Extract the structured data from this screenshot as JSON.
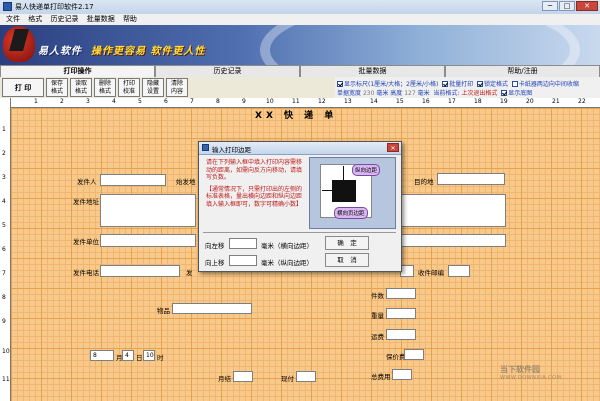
{
  "window": {
    "title": "易人快递单打印软件2.17",
    "min": "─",
    "max": "□",
    "close": "✕"
  },
  "menu": [
    "文件",
    "格式",
    "历史记录",
    "批量数据",
    "帮助"
  ],
  "banner": {
    "slogan_a": "易人软件",
    "slogan_b": "操作更容易  软件更人性"
  },
  "tabs": [
    "打印操作",
    "历史记录",
    "批量数据",
    "帮助/注册"
  ],
  "toolbar": {
    "print": "打 印",
    "buttons": [
      "保存\n格式",
      "读取\n格式",
      "删除\n格式",
      "打印\n校准",
      "隐藏\n设置",
      "清除\n内容"
    ]
  },
  "options": {
    "row1_a": "显示标尺(1厘米/大格；2厘米/小格)",
    "row1_b": "批量打印",
    "row1_c": "锁定格式",
    "row1_d": "卡纸器两边向中间收缩",
    "row2_label_w": "单据宽度",
    "row2_w": "230",
    "row2_unit_w": "毫米",
    "row2_label_h": "高度",
    "row2_h": "127",
    "row2_unit_h": "毫米",
    "row2_cur": "当前格式:",
    "row2_cur_val": "上次退出格式",
    "row2_bg": "显示底图"
  },
  "ruler": {
    "top": [
      "1",
      "2",
      "3",
      "4",
      "5",
      "6",
      "7",
      "8",
      "9",
      "10",
      "11",
      "12",
      "13",
      "14",
      "15",
      "16",
      "17",
      "18",
      "19",
      "20",
      "21",
      "22"
    ],
    "left": [
      "1",
      "2",
      "3",
      "4",
      "5",
      "6",
      "7",
      "8",
      "9",
      "10",
      "11"
    ]
  },
  "form": {
    "title": "XX 快 递 单",
    "sender": "发件人",
    "from": "始发地",
    "dest": "目的地",
    "sender_addr": "发件地址",
    "sender_org": "发件单位",
    "sender_phone": "发件电话",
    "tel_short": "发",
    "recv_zip": "收件邮编",
    "pieces": "件数",
    "goods": "物品",
    "weight": "重量",
    "freight": "运费",
    "insured": "保价费",
    "total": "总费用",
    "date_month": "月",
    "date_day": "日",
    "date_time": "时",
    "month_val": "8",
    "day_val": "4",
    "time_val": "10",
    "prepaid": "月结",
    "cod": "现付"
  },
  "dialog": {
    "title": "输入打印边距",
    "desc1": "请在下列输入框中填入打印内容需移动的距离，如需向反方向移动，请填写负数。",
    "desc2": "【通常情况下，只需打印出的左侧的标准表格，量出横向边距和纵向边距填入输入框即可，数字可精确小数】",
    "bubble_v": "纵向边距",
    "bubble_h": "横向页边距",
    "left_label": "向左移",
    "left_unit": "毫米（横向边距）",
    "up_label": "向上移",
    "up_unit": "毫米（纵向边距）",
    "ok": "确　定",
    "cancel": "取　消"
  },
  "watermark": {
    "main": "当下软件园",
    "sub": "WWW.DOWNXIA.COM"
  }
}
